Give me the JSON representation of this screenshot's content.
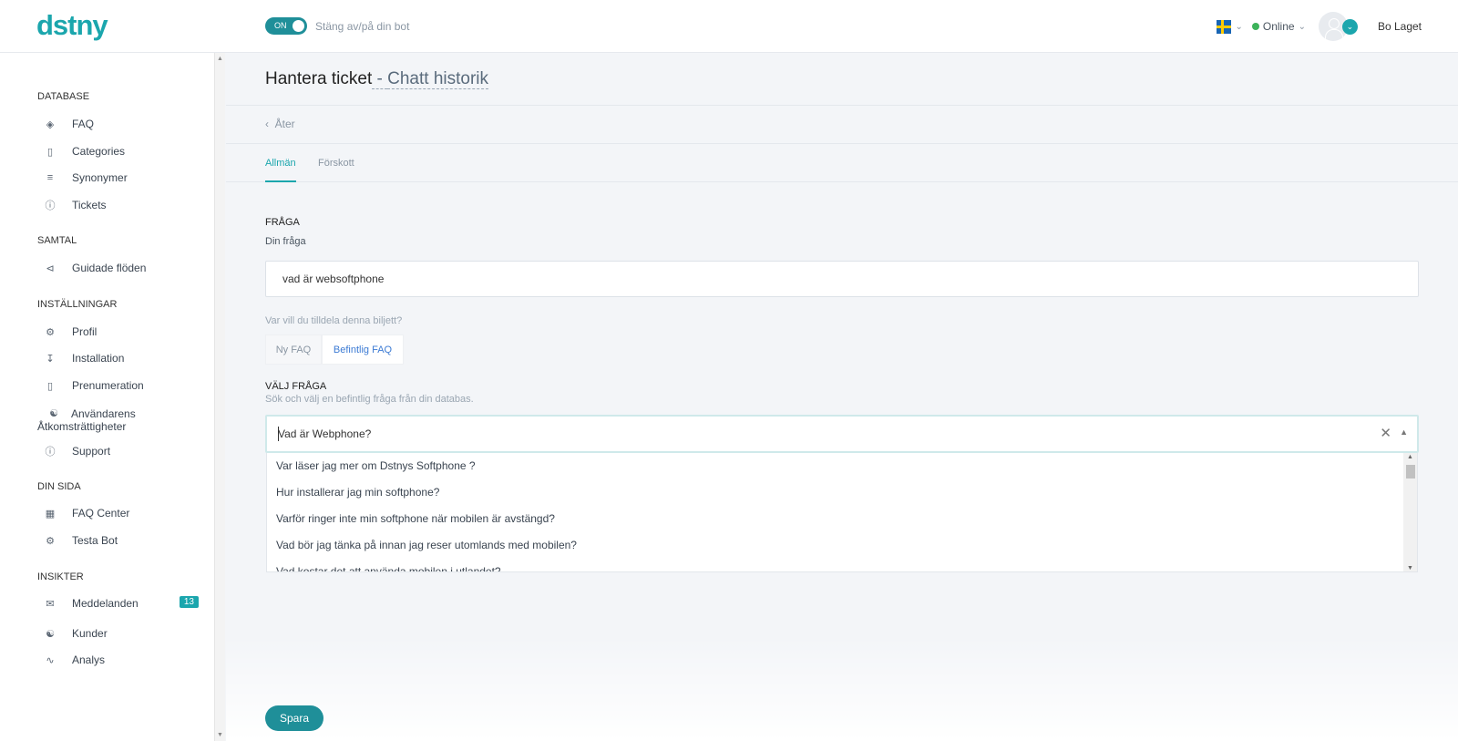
{
  "header": {
    "logo": "dstny",
    "toggle_state": "ON",
    "toggle_text": "Stäng av/på din bot",
    "status": "Online",
    "username": "Bo Laget"
  },
  "sidebar": {
    "sections": {
      "database": "DATABASE",
      "samtal": "SAMTAL",
      "installningar": "INSTÄLLNINGAR",
      "din_sida": "DIN SIDA",
      "insikter": "INSIKTER"
    },
    "items": {
      "faq": "FAQ",
      "categories": "Categories",
      "synonymer": "Synonymer",
      "tickets": "Tickets",
      "guidade": "Guidade flöden",
      "profil": "Profil",
      "installation": "Installation",
      "prenumeration": "Prenumeration",
      "anvandarens": "Användarens Åtkomsträttigheter",
      "support": "Support",
      "faq_center": "FAQ Center",
      "testa_bot": "Testa Bot",
      "meddelanden": "Meddelanden",
      "meddelanden_badge": "13",
      "kunder": "Kunder",
      "analys": "Analys"
    }
  },
  "page": {
    "title": "Hantera ticket",
    "title_separator": " - ",
    "subtitle": "Chatt historik",
    "back": "Åter",
    "tabs": [
      "Allmän",
      "Förskott"
    ]
  },
  "form": {
    "question_heading": "FRÅGA",
    "question_label": "Din fråga",
    "question_value": "vad är websoftphone",
    "assign_question": "Var vill du tilldela denna biljett?",
    "option_new": "Ny FAQ",
    "option_existing": "Befintlig FAQ",
    "select_heading": "VÄLJ FRÅGA",
    "select_help": "Sök och välj en befintlig fråga från din databas.",
    "select_value": "Vad är Webphone?",
    "dropdown_options": [
      "Var läser jag mer om Dstnys Softphone ?",
      "Hur installerar jag min softphone?",
      "Varför ringer inte min softphone när mobilen är avstängd?",
      "Vad bör jag tänka på innan jag reser utomlands med mobilen?",
      "Vad kostar det att använda mobilen i utlandet?"
    ],
    "save": "Spara"
  },
  "colors": {
    "brand": "#1ba6ad",
    "button": "#1f8f99",
    "link_active": "#3c7bd4",
    "online": "#3cb35a"
  }
}
